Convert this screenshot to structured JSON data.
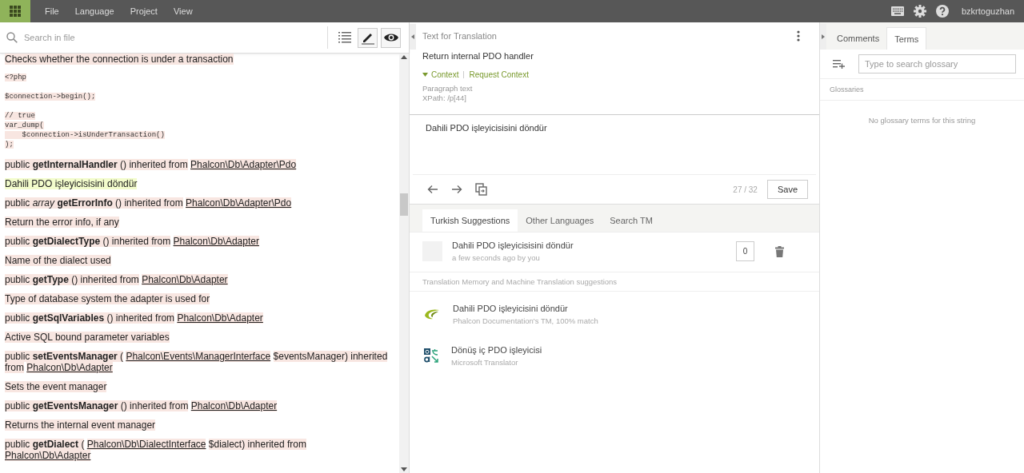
{
  "topbar": {
    "menu": [
      "File",
      "Language",
      "Project",
      "View"
    ],
    "user": "bzkrtoguzhan"
  },
  "file_panel": {
    "search": {
      "placeholder": "Search in file"
    },
    "tools": [
      {
        "kind": "list",
        "selected": false
      },
      {
        "kind": "edit",
        "selected": true
      },
      {
        "kind": "preview",
        "selected": true
      }
    ],
    "intro": "Checks whether the connection is under a transaction",
    "code": [
      [
        "<?php"
      ],
      [
        "$connection->begin();"
      ],
      [
        "// true",
        "var_dump(",
        "    $connection->isUnderTransaction()",
        ");"
      ]
    ],
    "paragraphs": [
      {
        "selected": false,
        "segments": [
          {
            "kind": "text",
            "text": "public **getInternalHandler** () inherited from"
          },
          {
            "kind": "link",
            "text": "Phalcon\\Db\\Adapter\\Pdo"
          }
        ]
      },
      {
        "selected": true,
        "segments": [
          {
            "kind": "text",
            "text": "Dahili PDO işleyicisisini döndür"
          }
        ]
      },
      {
        "selected": false,
        "segments": [
          {
            "kind": "text",
            "text": "public *array* **getErrorInfo** () inherited from"
          },
          {
            "kind": "link",
            "text": "Phalcon\\Db\\Adapter\\Pdo"
          }
        ]
      },
      {
        "selected": false,
        "segments": [
          {
            "kind": "text",
            "text": "Return the error info, if any"
          }
        ]
      },
      {
        "selected": false,
        "segments": [
          {
            "kind": "text",
            "text": "public **getDialectType** () inherited from"
          },
          {
            "kind": "link",
            "text": "Phalcon\\Db\\Adapter"
          }
        ]
      },
      {
        "selected": false,
        "segments": [
          {
            "kind": "text",
            "text": "Name of the dialect used"
          }
        ]
      },
      {
        "selected": false,
        "segments": [
          {
            "kind": "text",
            "text": "public **getType** () inherited from"
          },
          {
            "kind": "link",
            "text": "Phalcon\\Db\\Adapter"
          }
        ]
      },
      {
        "selected": false,
        "segments": [
          {
            "kind": "text",
            "text": "Type of database system the adapter is used for"
          }
        ]
      },
      {
        "selected": false,
        "segments": [
          {
            "kind": "text",
            "text": "public **getSqlVariables** () inherited from"
          },
          {
            "kind": "link",
            "text": "Phalcon\\Db\\Adapter"
          }
        ]
      },
      {
        "selected": false,
        "segments": [
          {
            "kind": "text",
            "text": "Active SQL bound parameter variables"
          }
        ]
      },
      {
        "selected": false,
        "segments": [
          {
            "kind": "text",
            "text": "public **setEventsManager** ("
          },
          {
            "kind": "link",
            "text": "Phalcon\\Events\\ManagerInterface"
          },
          {
            "kind": "text",
            "text": "$eventsManager) inherited"
          },
          {
            "kind": "text",
            "text": "from"
          },
          {
            "kind": "link",
            "text": "Phalcon\\Db\\Adapter"
          }
        ]
      },
      {
        "selected": false,
        "segments": [
          {
            "kind": "text",
            "text": "Sets the event manager"
          }
        ]
      },
      {
        "selected": false,
        "segments": [
          {
            "kind": "text",
            "text": "public **getEventsManager** () inherited from"
          },
          {
            "kind": "link",
            "text": "Phalcon\\Db\\Adapter"
          }
        ]
      },
      {
        "selected": false,
        "segments": [
          {
            "kind": "text",
            "text": "Returns the internal event manager"
          }
        ]
      },
      {
        "selected": false,
        "segments": [
          {
            "kind": "text",
            "text": "public **getDialect** ("
          },
          {
            "kind": "link",
            "text": "Phalcon\\Db\\DialectInterface"
          },
          {
            "kind": "text",
            "text": "$dialect) inherited from"
          },
          {
            "kind": "link",
            "text": "Phalcon\\Db\\Adapter"
          }
        ]
      }
    ]
  },
  "editor": {
    "title": "Text for Translation",
    "source": "Return internal PDO handler",
    "context_toggle": "Context",
    "request_context": "Request Context",
    "context_lines": [
      "Paragraph text",
      "XPath: /p[44]"
    ],
    "translation": "Dahili PDO işleyicisisini döndür",
    "progress": "27 / 32",
    "save": "Save",
    "tabs": [
      {
        "label": "Turkish Suggestions",
        "selected": true
      },
      {
        "label": "Other Languages",
        "selected": false
      },
      {
        "label": "Search TM",
        "selected": false
      }
    ],
    "own_suggestion": {
      "text": "Dahili PDO işleyicisisini döndür",
      "meta": "a few seconds ago by you",
      "votes": "0"
    },
    "tm_heading": "Translation Memory and Machine Translation suggestions",
    "suggestions": [
      {
        "kind": "tm",
        "text": "Dahili PDO işleyicisini döndür",
        "source": "Phalcon Documentation's TM, 100% match"
      },
      {
        "kind": "mt",
        "text": "Dönüş iç PDO işleyicisi",
        "source": "Microsoft Translator"
      }
    ]
  },
  "side_panel": {
    "tabs": [
      {
        "label": "Comments",
        "selected": false
      },
      {
        "label": "Terms",
        "selected": true
      }
    ],
    "search": {
      "placeholder": "Type to search glossary"
    },
    "heading": "Glossaries",
    "empty": "No glossary terms for this string"
  }
}
